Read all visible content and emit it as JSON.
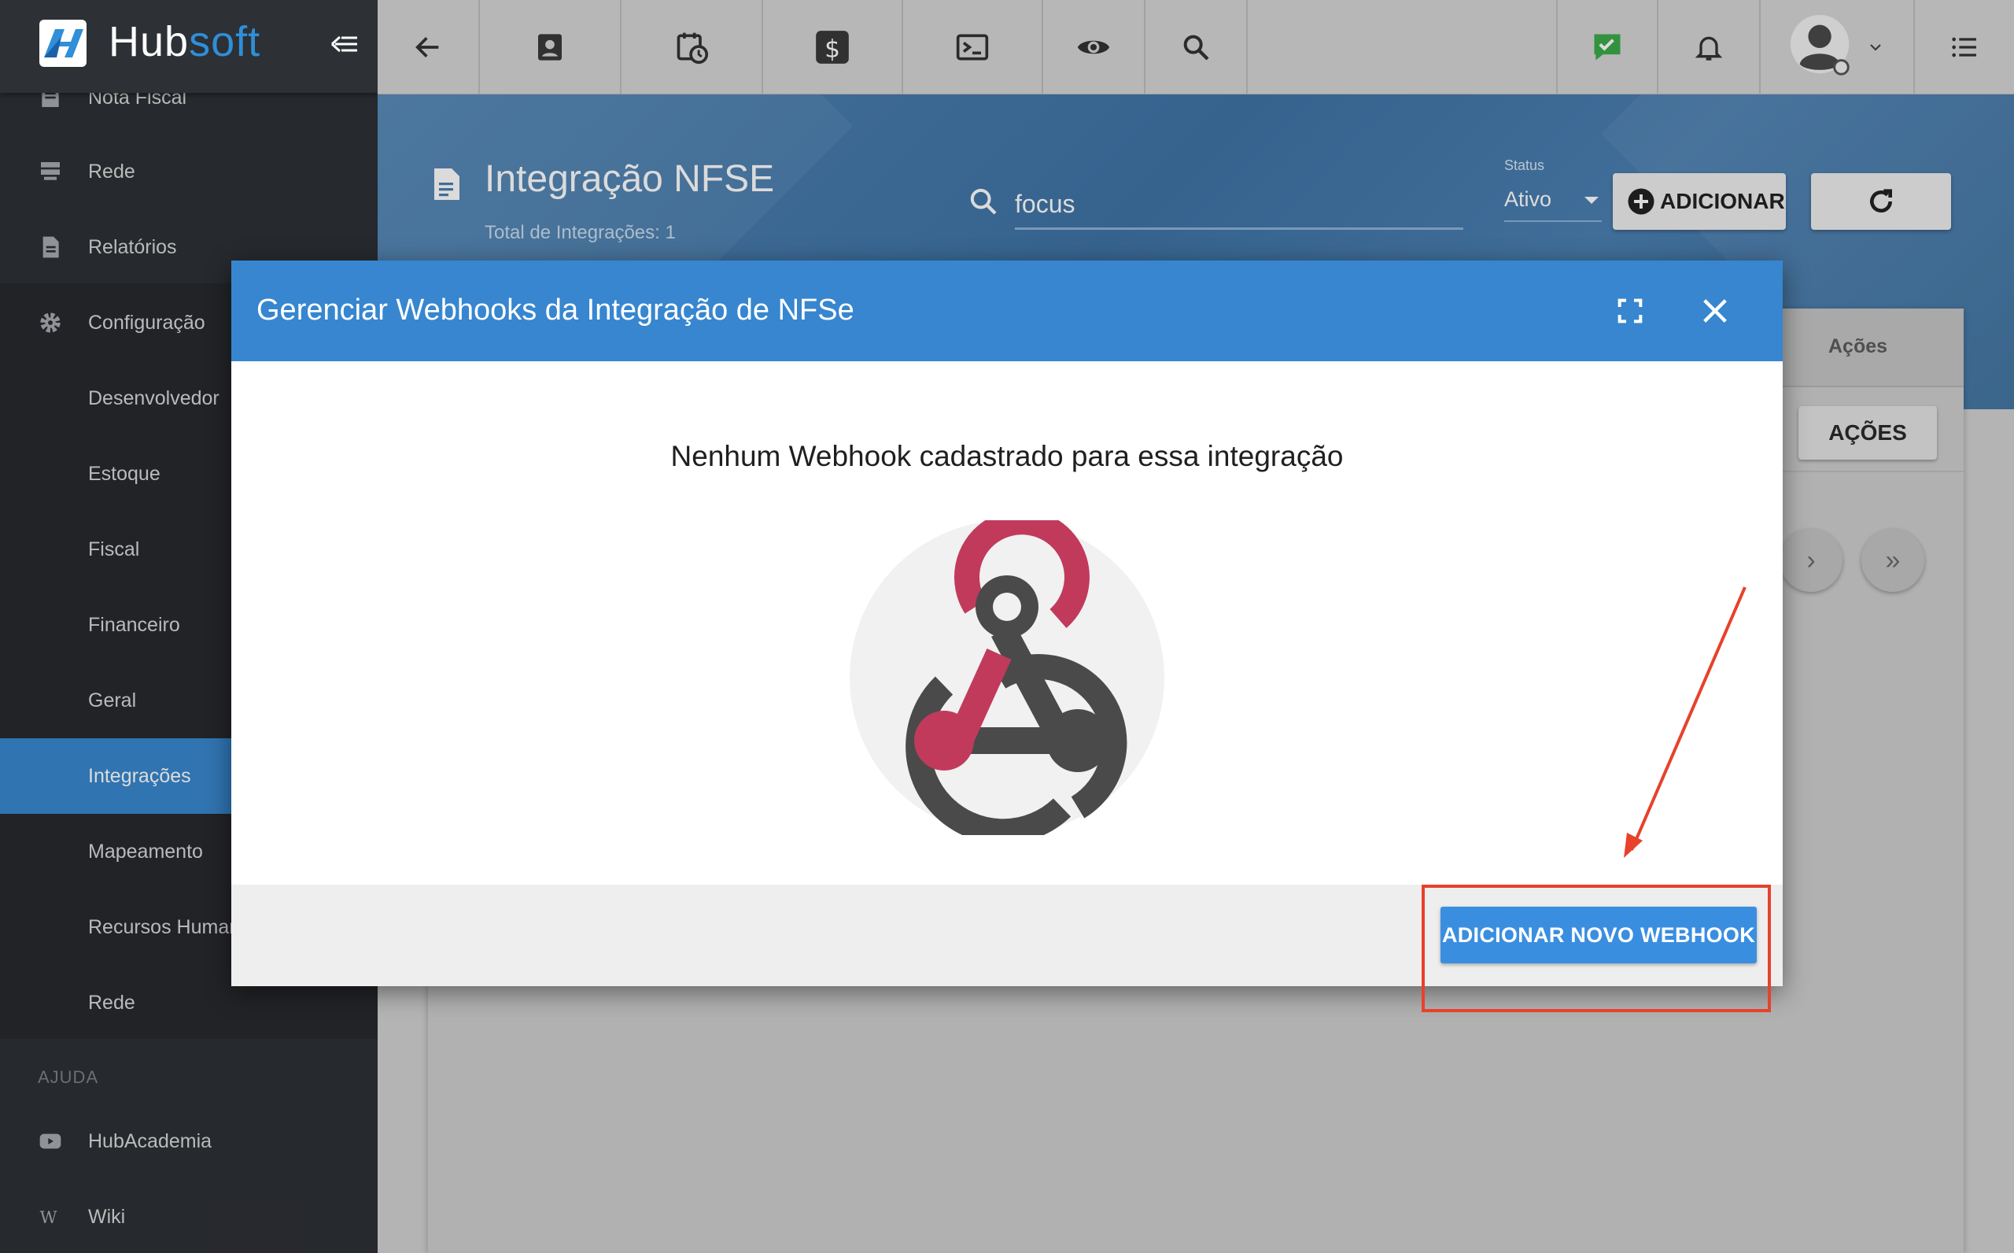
{
  "brand": {
    "name_part1": "Hub",
    "name_part2": "soft"
  },
  "sidebar": {
    "items": [
      {
        "label": "Nota Fiscal",
        "icon": "receipt-icon"
      },
      {
        "label": "Rede",
        "icon": "server-icon"
      },
      {
        "label": "Relatórios",
        "icon": "document-icon"
      },
      {
        "label": "Configuração",
        "icon": "gear-icon"
      },
      {
        "label": "Desenvolvedor"
      },
      {
        "label": "Estoque"
      },
      {
        "label": "Fiscal"
      },
      {
        "label": "Financeiro"
      },
      {
        "label": "Geral"
      },
      {
        "label": "Integrações",
        "active": true
      },
      {
        "label": "Mapeamento"
      },
      {
        "label": "Recursos Humanos"
      },
      {
        "label": "Rede"
      }
    ],
    "section_help": "AJUDA",
    "help_items": [
      {
        "label": "HubAcademia",
        "icon": "youtube-icon"
      },
      {
        "label": "Wiki",
        "icon": "wikipedia-icon"
      }
    ]
  },
  "topbar": {
    "icons": [
      "back-arrow-icon",
      "contact-icon",
      "calendar-clock-icon",
      "dollar-icon",
      "terminal-icon",
      "eye-icon",
      "search-icon",
      "chat-check-icon",
      "bell-icon",
      "user-avatar",
      "menu-list-icon"
    ]
  },
  "page": {
    "title": "Integração NFSE",
    "subtitle": "Total de Integrações: 1",
    "search_value": "focus",
    "status_label": "Status",
    "status_value": "Ativo",
    "add_button": "ADICIONAR"
  },
  "table": {
    "header_actions": "Ações",
    "row_actions_button": "AÇÕES",
    "pager_next": "›",
    "pager_last": "»"
  },
  "modal": {
    "title": "Gerenciar Webhooks da Integração de NFSe",
    "empty_message": "Nenhum Webhook cadastrado para essa integração",
    "add_webhook_button": "ADICIONAR NOVO WEBHOOK"
  },
  "colors": {
    "sidebar_bg": "#2d3035",
    "accent_blue": "#3786cf",
    "webhook_pink": "#c13a5c",
    "webhook_gray": "#4a4a4a",
    "annotation_red": "#e8412c"
  }
}
